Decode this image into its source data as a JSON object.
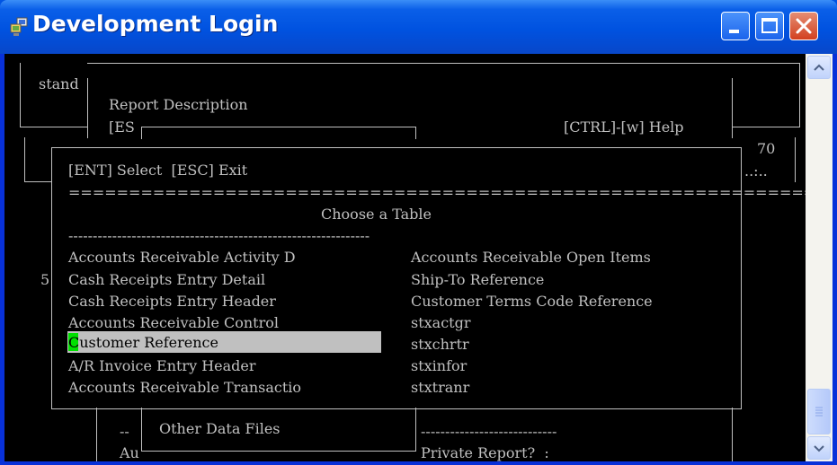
{
  "window": {
    "title": "Development Login"
  },
  "icons": {
    "app": "network-computer-icon",
    "minimize": "minimize-icon",
    "maximize": "maximize-icon",
    "close": "close-icon"
  },
  "terminal": {
    "outer_label": "stand",
    "report_box": {
      "title": "Report Description",
      "esc_fragment": "[ES",
      "help": "[CTRL]-[w] Help"
    },
    "right_marks": {
      "num": "70",
      "dots": "..:.."
    },
    "left_mark": "5|",
    "dialog": {
      "hint": "[ENT] Select  [ESC] Exit",
      "equals_rule": "==============================================================",
      "heading": "Choose a Table",
      "dash_rule": "--------------------------------------------------------------",
      "left_items": [
        "Accounts Receivable Activity D",
        "Cash Receipts Entry Detail",
        "Cash Receipts Entry Header",
        "Accounts Receivable Control",
        "Customer Reference",
        "A/R Invoice Entry Header",
        "Accounts Receivable Transactio"
      ],
      "right_items": [
        "Accounts Receivable Open Items",
        "Ship-To Reference",
        "Customer Terms Code Reference",
        "stxactgr",
        "stxchrtr",
        "stxinfor",
        "stxtranr"
      ],
      "selected_index": 4
    },
    "bottom": {
      "dashes_left": "--",
      "au_fragment": "Au",
      "other_files": "Other Data Files",
      "dash_line": "----------------------------",
      "private_report": "Private Report?  :"
    }
  }
}
